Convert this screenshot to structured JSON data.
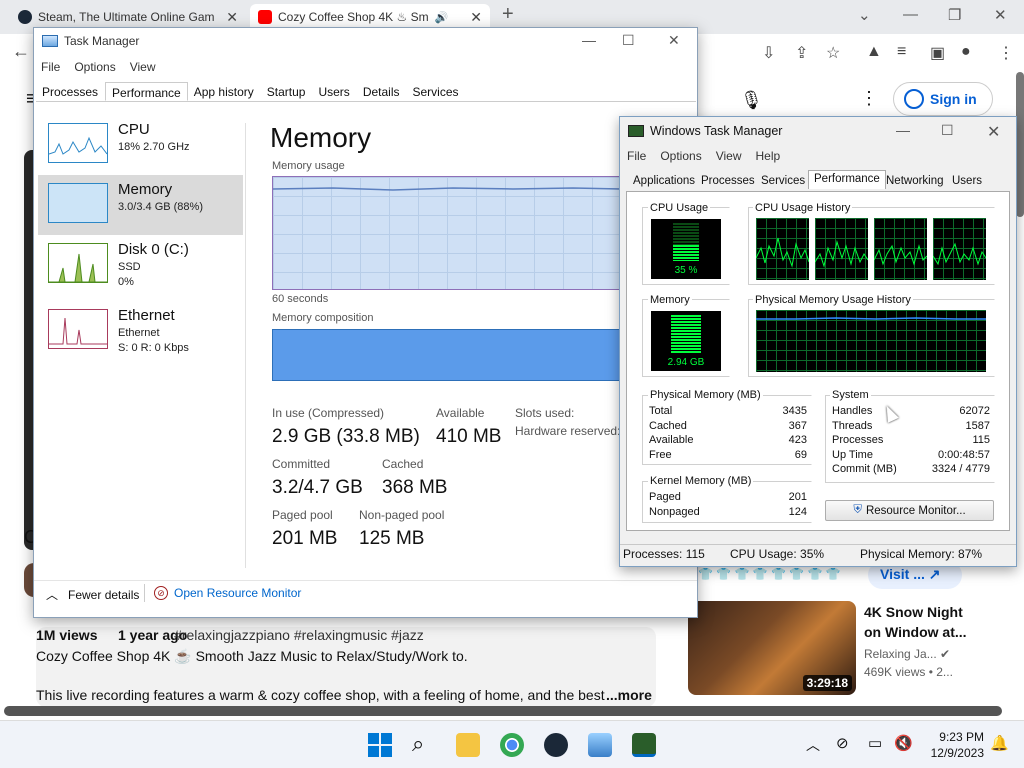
{
  "browser": {
    "tabs": [
      {
        "title": "Steam, The Ultimate Online Gam"
      },
      {
        "title": "Cozy Coffee Shop 4K ♨ Sm"
      }
    ],
    "new_tab": "+",
    "window_controls": [
      "⌄",
      "—",
      "❐",
      "✕"
    ]
  },
  "youtube": {
    "signin": "Sign in",
    "views": "1M views",
    "age": "1 year ago",
    "tags": "#relaxingjazzpiano #relaxingmusic #jazz",
    "video_title": "Cozy Coffee Shop 4K ☕ Smooth Jazz Music to Relax/Study/Work to.",
    "description": "This live recording features a warm & cozy coffee shop, with a feeling of home, and the best",
    "more": "...more",
    "visit": "Visit ...",
    "rec_title_1": "4K Snow Night",
    "rec_title_2": "on Window at...",
    "rec_channel": "Relaxing Ja...",
    "rec_meta": "469K views • 2...",
    "rec_duration": "3:29:18",
    "left_letter": "C"
  },
  "tm1": {
    "title": "Task Manager",
    "menu": [
      "File",
      "Options",
      "View"
    ],
    "tabs": [
      "Processes",
      "Performance",
      "App history",
      "Startup",
      "Users",
      "Details",
      "Services"
    ],
    "items": [
      {
        "name": "CPU",
        "sub1": "18% 2.70 GHz",
        "sub2": "",
        "sub3": ""
      },
      {
        "name": "Memory",
        "sub1": "3.0/3.4 GB (88%)",
        "sub2": "",
        "sub3": ""
      },
      {
        "name": "Disk 0 (C:)",
        "sub1": "SSD",
        "sub2": "0%",
        "sub3": ""
      },
      {
        "name": "Ethernet",
        "sub1": "Ethernet",
        "sub2": "S: 0 R: 0 Kbps",
        "sub3": ""
      }
    ],
    "heading": "Memory",
    "usage_label": "Memory usage",
    "seconds": "60 seconds",
    "composition": "Memory composition",
    "in_use_label": "In use (Compressed)",
    "in_use": "2.9 GB (33.8 MB)",
    "available_label": "Available",
    "available": "410 MB",
    "slots_label": "Slots used:",
    "hw_label": "Hardware reserved:",
    "committed_label": "Committed",
    "committed": "3.2/4.7 GB",
    "cached_label": "Cached",
    "cached": "368 MB",
    "paged_label": "Paged pool",
    "paged": "201 MB",
    "nonpaged_label": "Non-paged pool",
    "nonpaged": "125 MB",
    "fewer": "Fewer details",
    "open_rm": "Open Resource Monitor"
  },
  "tm2": {
    "title": "Windows Task Manager",
    "menu": [
      "File",
      "Options",
      "View",
      "Help"
    ],
    "tabs": [
      "Applications",
      "Processes",
      "Services",
      "Performance",
      "Networking",
      "Users"
    ],
    "cpu_usage_label": "CPU Usage",
    "cpu_value": "35 %",
    "cpu_history_label": "CPU Usage History",
    "memory_label": "Memory",
    "memory_value": "2.94 GB",
    "mem_history_label": "Physical Memory Usage History",
    "physical": {
      "label": "Physical Memory (MB)",
      "rows": [
        [
          "Total",
          "3435"
        ],
        [
          "Cached",
          "367"
        ],
        [
          "Available",
          "423"
        ],
        [
          "Free",
          "69"
        ]
      ]
    },
    "kernel": {
      "label": "Kernel Memory (MB)",
      "rows": [
        [
          "Paged",
          "201"
        ],
        [
          "Nonpaged",
          "124"
        ]
      ]
    },
    "system": {
      "label": "System",
      "rows": [
        [
          "Handles",
          "62072"
        ],
        [
          "Threads",
          "1587"
        ],
        [
          "Processes",
          "115"
        ],
        [
          "Up Time",
          "0:00:48:57"
        ],
        [
          "Commit (MB)",
          "3324 / 4779"
        ]
      ]
    },
    "rm_button": "Resource Monitor...",
    "status": [
      "Processes: 115",
      "CPU Usage: 35%",
      "Physical Memory: 87%"
    ]
  },
  "taskbar": {
    "time": "9:23 PM",
    "date": "12/9/2023"
  },
  "colors": {
    "accent": "#0067c0",
    "tm_blue": "#2b87c6",
    "green": "#00ff3c"
  }
}
